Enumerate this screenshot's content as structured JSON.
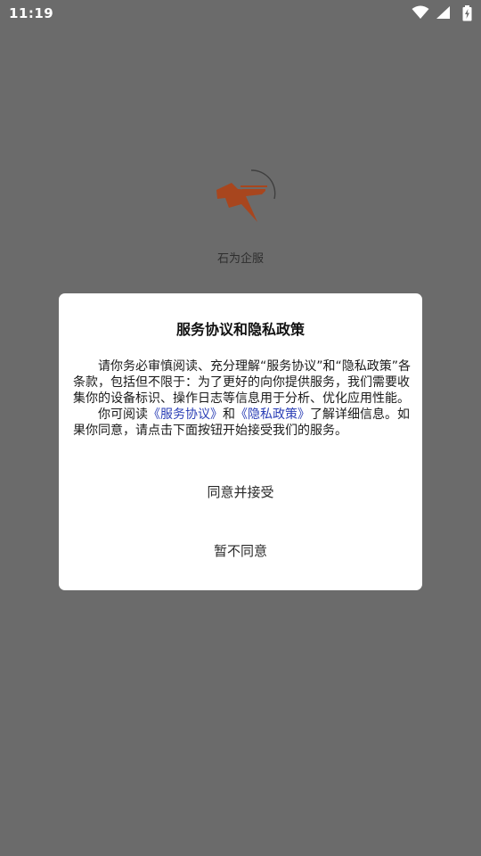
{
  "status_bar": {
    "time": "11:19",
    "icons": [
      "wifi-icon",
      "signal-icon",
      "battery-charging-icon"
    ]
  },
  "splash": {
    "app_name": "石为企服",
    "logo_color": "#a8461e"
  },
  "dialog": {
    "title": "服务协议和隐私政策",
    "paragraph1": "请你务必审慎阅读、充分理解“服务协议”和“隐私政策”各条款，包括但不限于：为了更好的向你提供服务，我们需要收集你的设备标识、操作日志等信息用于分析、优化应用性能。",
    "p2_prefix": "你可阅读",
    "service_link": "《服务协议》",
    "p2_and": "和",
    "privacy_link": "《隐私政策》",
    "p2_suffix": "了解详细信息。如果你同意，请点击下面按钮开始接受我们的服务。",
    "accept_label": "同意并接受",
    "decline_label": "暂不同意",
    "link_color": "#2b3fb6"
  }
}
